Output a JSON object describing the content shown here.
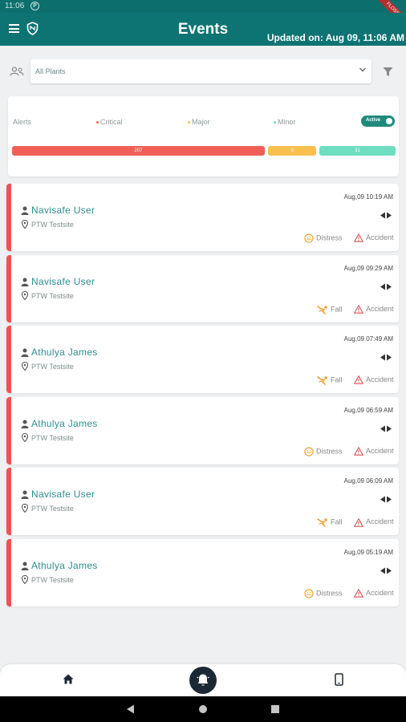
{
  "status_bar": {
    "time": "11:06"
  },
  "ribbon": {
    "label": "FLOSS"
  },
  "header": {
    "title": "Events",
    "updated": "Updated on: Aug 09, 11:06 AM"
  },
  "filter": {
    "plant_value": "All Plants"
  },
  "alerts": {
    "label": "Alerts",
    "legend": {
      "critical": "Critical",
      "major": "Major",
      "minor": "Minor"
    },
    "toggle_label": "Active",
    "counts": {
      "critical": "207",
      "major": "3",
      "minor": "31"
    },
    "colors": {
      "critical": "#f05f57",
      "major": "#f8c04f",
      "minor": "#6fddc0",
      "accent": "#0e7373"
    }
  },
  "events": [
    {
      "name": "Navisafe  User",
      "site": "PTW Testsite",
      "time": "Aug,09 10:19 AM",
      "tag1": "Distress",
      "tag1_icon": "distress-icon",
      "tag2": "Accident"
    },
    {
      "name": "Navisafe  User",
      "site": "PTW Testsite",
      "time": "Aug,09 09:29 AM",
      "tag1": "Fall",
      "tag1_icon": "fall-icon",
      "tag2": "Accident"
    },
    {
      "name": "Athulya  James",
      "site": "PTW Testsite",
      "time": "Aug,09 07:49 AM",
      "tag1": "Fall",
      "tag1_icon": "fall-icon",
      "tag2": "Accident"
    },
    {
      "name": "Athulya  James",
      "site": "PTW Testsite",
      "time": "Aug,09 06:59 AM",
      "tag1": "Distress",
      "tag1_icon": "distress-icon",
      "tag2": "Accident"
    },
    {
      "name": "Navisafe  User",
      "site": "PTW Testsite",
      "time": "Aug,09 06:09 AM",
      "tag1": "Fall",
      "tag1_icon": "fall-icon",
      "tag2": "Accident"
    },
    {
      "name": "Athulya  James",
      "site": "PTW Testsite",
      "time": "Aug,09 05:19 AM",
      "tag1": "Distress",
      "tag1_icon": "distress-icon",
      "tag2": "Accident"
    }
  ]
}
